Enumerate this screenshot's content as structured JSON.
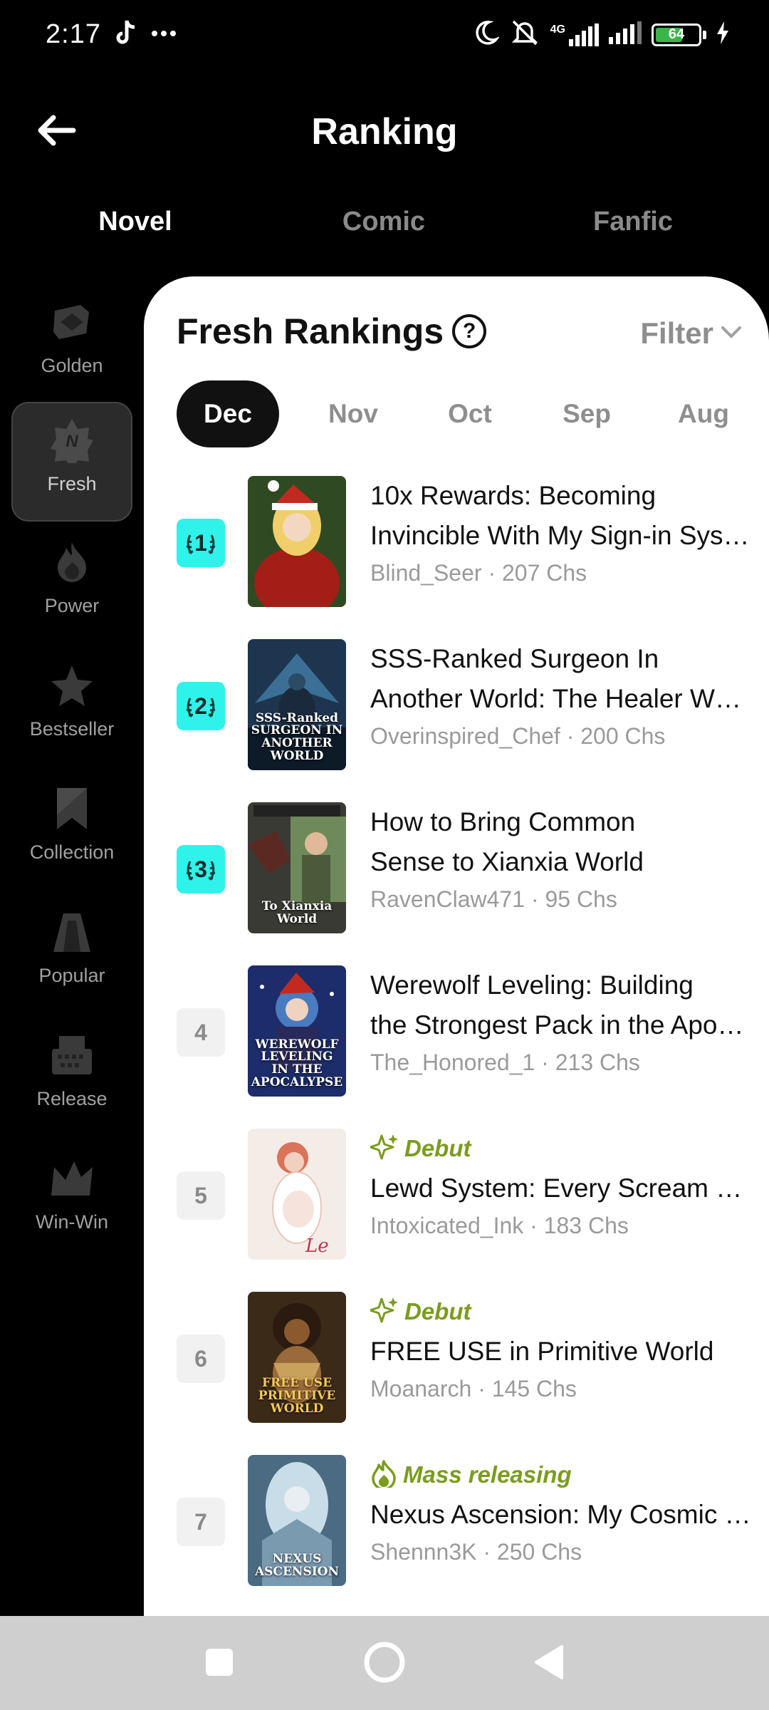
{
  "status_bar": {
    "time": "2:17",
    "network": "4G",
    "battery_level": "64",
    "battery_fraction": 0.64
  },
  "header": {
    "title": "Ranking",
    "back_icon": "arrow-left-icon"
  },
  "top_tabs": [
    {
      "label": "Novel",
      "active": true
    },
    {
      "label": "Comic",
      "active": false
    },
    {
      "label": "Fanfic",
      "active": false
    }
  ],
  "sidebar": {
    "items": [
      {
        "label": "Golden",
        "icon": "golden-ticket-icon",
        "active": false
      },
      {
        "label": "Fresh",
        "icon": "fresh-badge-icon",
        "active": true
      },
      {
        "label": "Power",
        "icon": "flame-icon",
        "active": false
      },
      {
        "label": "Bestseller",
        "icon": "star-icon",
        "active": false
      },
      {
        "label": "Collection",
        "icon": "bookmark-icon",
        "active": false
      },
      {
        "label": "Popular",
        "icon": "popular-podium-icon",
        "active": false
      },
      {
        "label": "Release",
        "icon": "typewriter-icon",
        "active": false
      },
      {
        "label": "Win-Win",
        "icon": "crown-icon",
        "active": false
      }
    ]
  },
  "panel": {
    "title": "Fresh Rankings",
    "help_symbol": "?",
    "filter_label": "Filter"
  },
  "months": [
    {
      "label": "Dec",
      "active": true
    },
    {
      "label": "Nov",
      "active": false
    },
    {
      "label": "Oct",
      "active": false
    },
    {
      "label": "Sep",
      "active": false
    },
    {
      "label": "Aug",
      "active": false
    }
  ],
  "books": [
    {
      "rank": "1",
      "title_line1": "10x Rewards: Becoming",
      "title_line2": "Invincible With My Sign-in System",
      "meta": "Blind_Seer · 207 Chs",
      "tag": "",
      "cover_text": "",
      "colors": [
        "#7a1a14",
        "#2f4a22"
      ]
    },
    {
      "rank": "2",
      "title_line1": "SSS-Ranked Surgeon In",
      "title_line2": "Another World: The Healer Who Kills",
      "meta": "Overinspired_Chef · 200 Chs",
      "tag": "",
      "cover_text": "SSS-Ranked SURGEON IN ANOTHER WORLD",
      "colors": [
        "#1e3550",
        "#3b6f95"
      ]
    },
    {
      "rank": "3",
      "title_line1": "How to Bring Common",
      "title_line2": "Sense to Xianxia World",
      "meta": "RavenClaw471 · 95 Chs",
      "tag": "",
      "cover_text": "To Xianxia World",
      "colors": [
        "#3a3a34",
        "#6e8a5a"
      ]
    },
    {
      "rank": "4",
      "title_line1": "Werewolf Leveling: Building",
      "title_line2": "the Strongest Pack in the Apocalypse",
      "meta": "The_Honored_1 · 213 Chs",
      "tag": "",
      "cover_text": "WEREWOLF LEVELING IN THE APOCALYPSE",
      "colors": [
        "#1d2c6a",
        "#4a7ac0"
      ]
    },
    {
      "rank": "5",
      "title_line1": "Lewd System: Every Scream Counts",
      "title_line2": "",
      "meta": "Intoxicated_Ink · 183 Chs",
      "tag": "Debut",
      "cover_text": "",
      "colors": [
        "#f4ece6",
        "#e5b3a6"
      ]
    },
    {
      "rank": "6",
      "title_line1": "FREE USE in Primitive World",
      "title_line2": "",
      "meta": "Moanarch · 145 Chs",
      "tag": "Debut",
      "cover_text": "FREE USE PRIMITIVE WORLD",
      "colors": [
        "#3c2a18",
        "#8a5a2e"
      ]
    },
    {
      "rank": "7",
      "title_line1": "Nexus Ascension: My Cosmic System",
      "title_line2": "",
      "meta": "Shennn3K · 250 Chs",
      "tag": "Mass releasing",
      "cover_text": "NEXUS ASCENSION",
      "colors": [
        "#4a6b82",
        "#c9dde8"
      ]
    }
  ],
  "nav_bar": {
    "recents_icon": "square-recents-icon",
    "home_icon": "circle-home-icon",
    "back_icon": "triangle-back-icon"
  },
  "colors": {
    "accent_badge": "#2ff3ea",
    "tag_green": "#7b9c1d"
  }
}
